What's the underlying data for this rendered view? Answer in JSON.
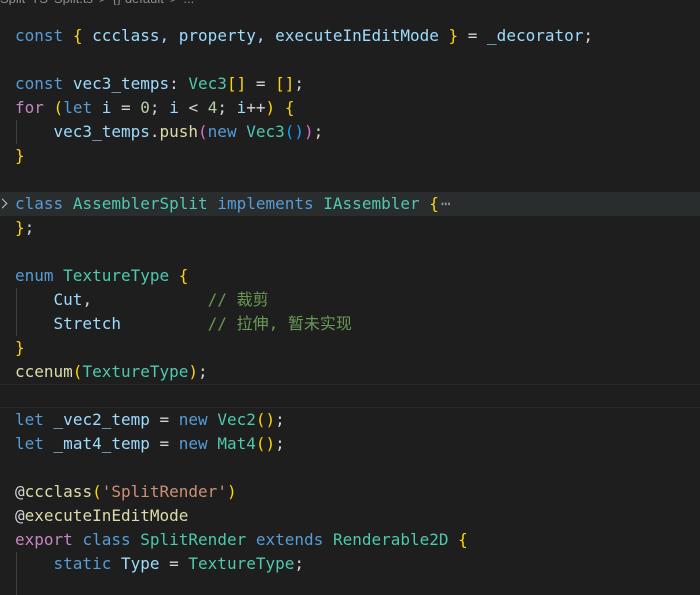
{
  "breadcrumb": [
    "Split",
    "TS",
    "Split.ts",
    ">",
    "{} default",
    ">",
    "..."
  ],
  "lines": [
    [
      {
        "t": "const",
        "c": "kw"
      },
      {
        "t": " ",
        "c": "punc"
      },
      {
        "t": "{",
        "c": "b1"
      },
      {
        "t": " ccclass, property, executeInEditMode ",
        "c": "var"
      },
      {
        "t": "}",
        "c": "b1"
      },
      {
        "t": " = ",
        "c": "punc"
      },
      {
        "t": "_decorator",
        "c": "var"
      },
      {
        "t": ";",
        "c": "punc"
      }
    ],
    [],
    [
      {
        "t": "const",
        "c": "kw"
      },
      {
        "t": " ",
        "c": "punc"
      },
      {
        "t": "vec3_temps",
        "c": "var"
      },
      {
        "t": ": ",
        "c": "punc"
      },
      {
        "t": "Vec3",
        "c": "type"
      },
      {
        "t": "[]",
        "c": "b1"
      },
      {
        "t": " = ",
        "c": "punc"
      },
      {
        "t": "[]",
        "c": "b1"
      },
      {
        "t": ";",
        "c": "punc"
      }
    ],
    [
      {
        "t": "for",
        "c": "ctrl"
      },
      {
        "t": " ",
        "c": "punc"
      },
      {
        "t": "(",
        "c": "b1"
      },
      {
        "t": "let",
        "c": "kw"
      },
      {
        "t": " ",
        "c": "punc"
      },
      {
        "t": "i",
        "c": "var"
      },
      {
        "t": " = ",
        "c": "punc"
      },
      {
        "t": "0",
        "c": "num"
      },
      {
        "t": "; ",
        "c": "punc"
      },
      {
        "t": "i",
        "c": "var"
      },
      {
        "t": " < ",
        "c": "punc"
      },
      {
        "t": "4",
        "c": "num"
      },
      {
        "t": "; ",
        "c": "punc"
      },
      {
        "t": "i",
        "c": "var"
      },
      {
        "t": "++",
        "c": "punc"
      },
      {
        "t": ")",
        "c": "b1"
      },
      {
        "t": " ",
        "c": "punc"
      },
      {
        "t": "{",
        "c": "b1"
      }
    ],
    [
      {
        "t": "    ",
        "c": "punc"
      },
      {
        "t": "vec3_temps",
        "c": "var"
      },
      {
        "t": ".",
        "c": "punc"
      },
      {
        "t": "push",
        "c": "fn"
      },
      {
        "t": "(",
        "c": "b2"
      },
      {
        "t": "new",
        "c": "kw"
      },
      {
        "t": " ",
        "c": "punc"
      },
      {
        "t": "Vec3",
        "c": "type"
      },
      {
        "t": "()",
        "c": "b3"
      },
      {
        "t": ")",
        "c": "b2"
      },
      {
        "t": ";",
        "c": "punc"
      }
    ],
    [
      {
        "t": "}",
        "c": "b1"
      }
    ],
    [],
    [
      {
        "t": "class",
        "c": "kw"
      },
      {
        "t": " ",
        "c": "punc"
      },
      {
        "t": "AssemblerSplit",
        "c": "type"
      },
      {
        "t": " ",
        "c": "punc"
      },
      {
        "t": "implements",
        "c": "kw"
      },
      {
        "t": " ",
        "c": "punc"
      },
      {
        "t": "IAssembler",
        "c": "type"
      },
      {
        "t": " ",
        "c": "punc"
      },
      {
        "t": "{",
        "c": "b1"
      }
    ],
    [
      {
        "t": "}",
        "c": "b1"
      },
      {
        "t": ";",
        "c": "punc"
      }
    ],
    [],
    [
      {
        "t": "enum",
        "c": "kw"
      },
      {
        "t": " ",
        "c": "punc"
      },
      {
        "t": "TextureType",
        "c": "type"
      },
      {
        "t": " ",
        "c": "punc"
      },
      {
        "t": "{",
        "c": "b1"
      }
    ],
    [
      {
        "t": "    ",
        "c": "punc"
      },
      {
        "t": "Cut",
        "c": "var"
      },
      {
        "t": ",            ",
        "c": "punc"
      },
      {
        "t": "// 裁剪",
        "c": "cmt"
      }
    ],
    [
      {
        "t": "    ",
        "c": "punc"
      },
      {
        "t": "Stretch",
        "c": "var"
      },
      {
        "t": "         ",
        "c": "punc"
      },
      {
        "t": "// 拉伸, 暂未实现",
        "c": "cmt"
      }
    ],
    [
      {
        "t": "}",
        "c": "b1"
      }
    ],
    [
      {
        "t": "ccenum",
        "c": "fn"
      },
      {
        "t": "(",
        "c": "b1"
      },
      {
        "t": "TextureType",
        "c": "type"
      },
      {
        "t": ")",
        "c": "b1"
      },
      {
        "t": ";",
        "c": "punc"
      }
    ],
    [],
    [
      {
        "t": "let",
        "c": "kw"
      },
      {
        "t": " ",
        "c": "punc"
      },
      {
        "t": "_vec2_temp",
        "c": "var"
      },
      {
        "t": " = ",
        "c": "punc"
      },
      {
        "t": "new",
        "c": "kw"
      },
      {
        "t": " ",
        "c": "punc"
      },
      {
        "t": "Vec2",
        "c": "type"
      },
      {
        "t": "()",
        "c": "b1"
      },
      {
        "t": ";",
        "c": "punc"
      }
    ],
    [
      {
        "t": "let",
        "c": "kw"
      },
      {
        "t": " ",
        "c": "punc"
      },
      {
        "t": "_mat4_temp",
        "c": "var"
      },
      {
        "t": " = ",
        "c": "punc"
      },
      {
        "t": "new",
        "c": "kw"
      },
      {
        "t": " ",
        "c": "punc"
      },
      {
        "t": "Mat4",
        "c": "type"
      },
      {
        "t": "()",
        "c": "b1"
      },
      {
        "t": ";",
        "c": "punc"
      }
    ],
    [],
    [
      {
        "t": "@",
        "c": "punc"
      },
      {
        "t": "ccclass",
        "c": "fn"
      },
      {
        "t": "(",
        "c": "b1"
      },
      {
        "t": "'SplitRender'",
        "c": "str"
      },
      {
        "t": ")",
        "c": "b1"
      }
    ],
    [
      {
        "t": "@",
        "c": "punc"
      },
      {
        "t": "executeInEditMode",
        "c": "fn"
      }
    ],
    [
      {
        "t": "export",
        "c": "ctrl"
      },
      {
        "t": " ",
        "c": "punc"
      },
      {
        "t": "class",
        "c": "kw"
      },
      {
        "t": " ",
        "c": "punc"
      },
      {
        "t": "SplitRender",
        "c": "type"
      },
      {
        "t": " ",
        "c": "punc"
      },
      {
        "t": "extends",
        "c": "kw"
      },
      {
        "t": " ",
        "c": "punc"
      },
      {
        "t": "Renderable2D",
        "c": "type"
      },
      {
        "t": " ",
        "c": "punc"
      },
      {
        "t": "{",
        "c": "b1"
      }
    ],
    [
      {
        "t": "    ",
        "c": "punc"
      },
      {
        "t": "static",
        "c": "kw"
      },
      {
        "t": " ",
        "c": "punc"
      },
      {
        "t": "Type",
        "c": "var"
      },
      {
        "t": " = ",
        "c": "punc"
      },
      {
        "t": "TextureType",
        "c": "type"
      },
      {
        "t": ";",
        "c": "punc"
      }
    ],
    []
  ],
  "folded_line_index": 7,
  "folded_ellipsis": "⋯",
  "current_line_index": 15
}
